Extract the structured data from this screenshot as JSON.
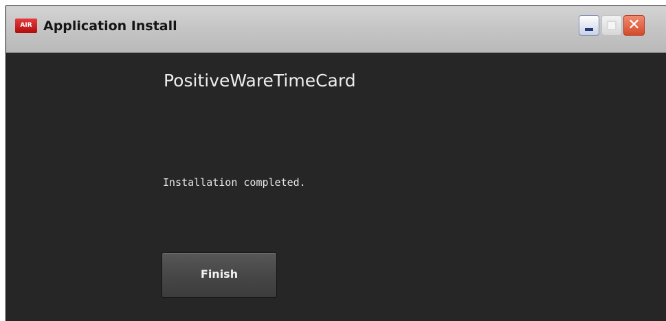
{
  "window": {
    "title": "Application Install",
    "app_icon_label": "AIR",
    "controls": {
      "minimize_icon": "minimize-icon",
      "maximize_icon": "maximize-icon",
      "close_icon": "close-icon",
      "close_glyph": "✕"
    }
  },
  "content": {
    "app_name": "PositiveWareTimeCard",
    "status_text": "Installation completed.",
    "finish_label": "Finish"
  },
  "colors": {
    "background": "#262626",
    "titlebar": "#c6c6c6",
    "close_button": "#d44a2c",
    "accent_icon": "#c41e1e"
  }
}
